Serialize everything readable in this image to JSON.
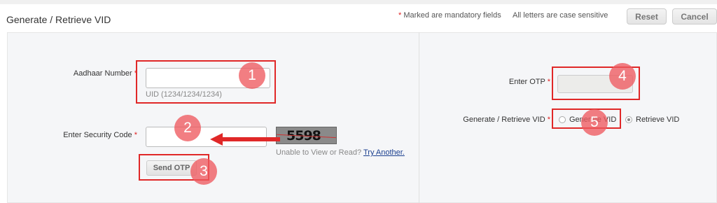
{
  "header": {
    "title": "Generate / Retrieve VID",
    "mandatory_note": "Marked are mandatory fields",
    "mandatory_star": "*",
    "case_note": "All letters are case sensitive",
    "reset_label": "Reset",
    "cancel_label": "Cancel"
  },
  "left": {
    "aadhaar_label": "Aadhaar Number",
    "aadhaar_value": "",
    "aadhaar_hint": "UID (1234/1234/1234)",
    "security_label": "Enter Security Code",
    "security_value": "",
    "captcha_text": "5598",
    "unable_text": "Unable to View or Read?",
    "try_another": "Try Another.",
    "send_otp_label": "Send OTP"
  },
  "right": {
    "otp_label": "Enter OTP",
    "otp_value": "",
    "vid_label": "Generate / Retrieve VID",
    "generate_option": "Generate VID",
    "retrieve_option": "Retrieve VID",
    "selected": "Retrieve VID"
  },
  "annotations": {
    "marker_1": "1",
    "marker_2": "2",
    "marker_3": "3",
    "marker_4": "4",
    "marker_5": "5",
    "color": "#e02828"
  },
  "colors": {
    "required_star": "#e02020",
    "link": "#1a3f8f",
    "panel": "#f5f6f8"
  }
}
